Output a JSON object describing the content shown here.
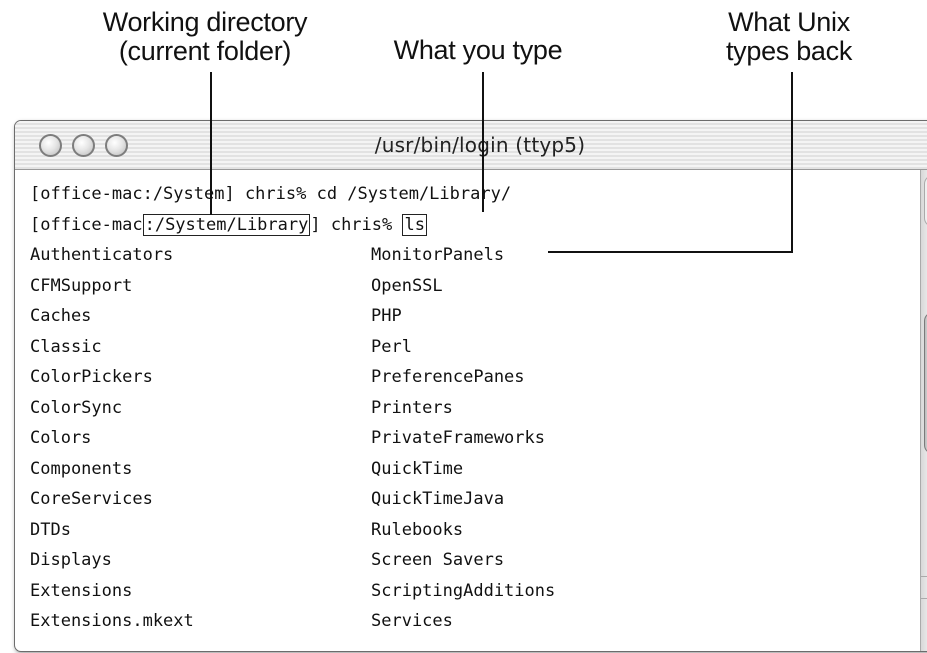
{
  "callouts": {
    "working_directory": [
      "Working directory",
      "(current folder)"
    ],
    "what_you_type": "What you type",
    "what_unix_types_back": [
      "What Unix",
      "types back"
    ]
  },
  "window": {
    "title": "/usr/bin/login  (ttyp5)"
  },
  "terminal": {
    "line1": {
      "prompt_a": "[office-mac:/Sys",
      "prompt_b": "tem] chris% cd /Syste",
      "prompt_c": "m/Library/"
    },
    "line2": {
      "prefix": "[office-mac",
      "path": ":/System/Library",
      "mid": "] chris% ",
      "command": "ls"
    },
    "listing_left": [
      "Authenticators",
      "CFMSupport",
      "Caches",
      "Classic",
      "ColorPickers",
      "ColorSync",
      "Colors",
      "Components",
      "CoreServices",
      "DTDs",
      "Displays",
      "Extensions",
      "Extensions.mkext"
    ],
    "listing_right": [
      "MonitorPanels",
      "OpenSSL",
      "PHP",
      "Perl",
      "PreferencePanes",
      "Printers",
      "PrivateFrameworks",
      "QuickTime",
      "QuickTimeJava",
      "Rulebooks",
      "Screen Savers",
      "ScriptingAdditions",
      "Services"
    ]
  },
  "icons": {
    "close": "close-button-icon",
    "minimize": "minimize-button-icon",
    "zoom": "zoom-button-icon",
    "scroll_up": "arrow-up-icon",
    "scroll_down": "arrow-down-icon",
    "resize": "resize-grip-icon"
  },
  "arrow_glyphs": {
    "up": "▲",
    "down": "▼"
  }
}
